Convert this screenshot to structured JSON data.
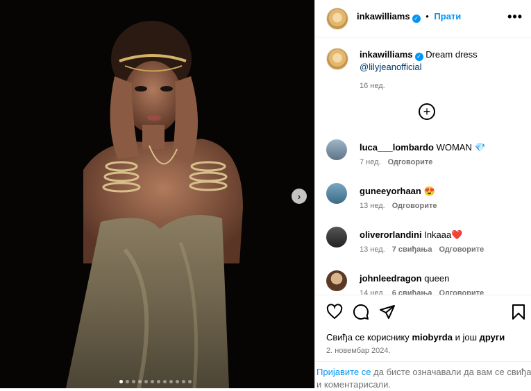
{
  "header": {
    "username": "inkawilliams",
    "follow_label": "Прати",
    "more_icon": "more-horizontal-icon"
  },
  "caption": {
    "username": "inkawilliams",
    "text": "Dream dress",
    "mention": "@lilyjeanofficial",
    "time": "16 нед."
  },
  "comments": [
    {
      "username": "luca___lombardo",
      "text": "WOMAN",
      "emoji": "💎",
      "time": "7 нед.",
      "likes": "",
      "reply": "Одговорите"
    },
    {
      "username": "guneeyorhaan",
      "text": "",
      "emoji": "😍",
      "time": "13 нед.",
      "likes": "",
      "reply": "Одговорите"
    },
    {
      "username": "oliverorlandini",
      "text": "Inkaaa",
      "emoji": "❤️",
      "time": "13 нед.",
      "likes": "7 свиђања",
      "reply": "Одговорите"
    },
    {
      "username": "johnleedragon",
      "text": "queen",
      "emoji": "",
      "time": "14 нед.",
      "likes": "6 свиђања",
      "reply": "Одговорите"
    }
  ],
  "likes_line": {
    "prefix": "Свиђа се кориснику",
    "user": "miobyrda",
    "middle": "и још",
    "others": "други"
  },
  "date": "2. новембар 2024.",
  "login_prompt": {
    "link": "Пријавите се",
    "text": "да бисте означавали да вам се свиђа и коментарисали."
  },
  "carousel": {
    "count": 12,
    "active_index": 0
  },
  "colors": {
    "accent": "#0095f6",
    "heart": "#ed4956"
  }
}
